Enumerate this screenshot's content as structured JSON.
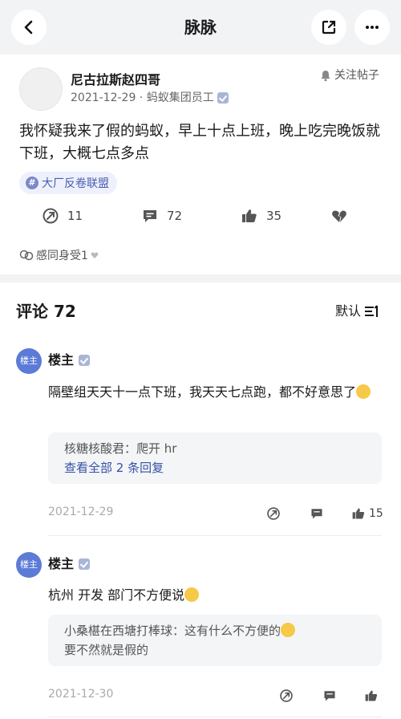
{
  "header": {
    "title": "脉脉"
  },
  "post": {
    "author": "尼古拉斯赵四哥",
    "meta": "2021-12-29 · 蚂蚁集团员工",
    "follow": "关注帖子",
    "text": "我怀疑我来了假的蚂蚁，早上十点上班，晚上吃完晚饭就下班，大概七点多点",
    "tag": "大厂反卷联盟",
    "shares": "11",
    "comments": "72",
    "likes": "35",
    "feel": "感同身受1"
  },
  "comments": {
    "header": "评论 72",
    "sort": "默认",
    "items": [
      {
        "avatar": "楼主",
        "name": "楼主",
        "text": "隔壁组天天十一点下班，我天天七点跑，都不好意思了",
        "reply_line": "核糖核酸君：爬开 hr",
        "reply_more": "查看全部 2 条回复",
        "date": "2021-12-29",
        "likes": "15"
      },
      {
        "avatar": "楼主",
        "name": "楼主",
        "text": "杭州 开发 部门不方便说",
        "reply_line": "小桑椹在西塘打棒球：这有什么不方便的",
        "reply_line2": "要不然就是假的",
        "date": "2021-12-30"
      }
    ]
  },
  "colors": {
    "accent": "#3451a8",
    "tag_bg": "#eef1fb",
    "badge": "#a9b6d6",
    "avatar": "#5b7bd6"
  }
}
